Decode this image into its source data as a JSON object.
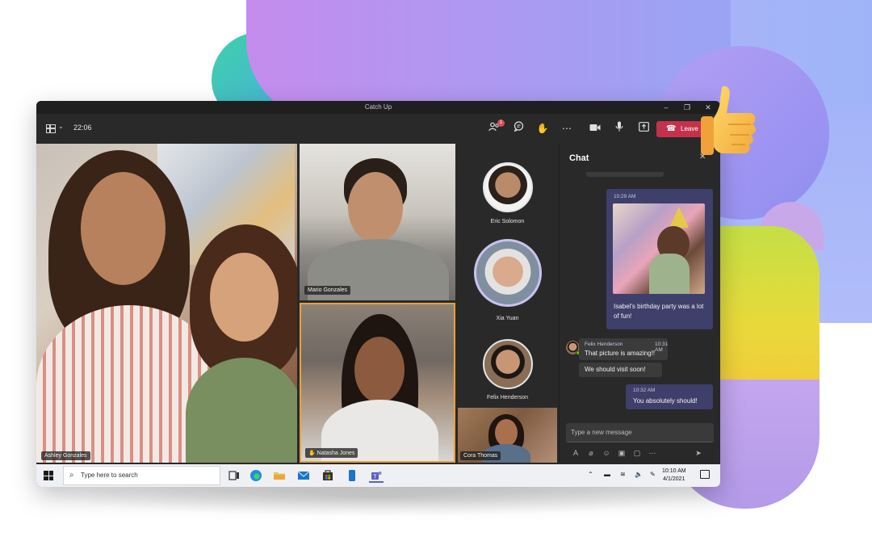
{
  "window": {
    "title": "Catch Up",
    "clock": "22:06",
    "notification_count": "1",
    "leave_label": "Leave"
  },
  "participants": {
    "ashley": "Ashley Gonzales",
    "mario": "Mario Gonzales",
    "natasha": "Natasha Jones",
    "cora": "Cora Thomas",
    "eric": "Eric Solomon",
    "xia": "Xia Yuan",
    "felix": "Felix Henderson"
  },
  "chat": {
    "title": "Chat",
    "messages": [
      {
        "sender": "self",
        "time": "10:29 AM",
        "text": "Isabel's birthday party was a lot of fun!"
      },
      {
        "sender": "Felix Henderson",
        "time": "10:31 AM",
        "text": "That picture is amazing!!"
      },
      {
        "sender": "Felix Henderson",
        "text": "We should visit soon!"
      },
      {
        "sender": "self",
        "time": "10:32 AM",
        "text": "You absolutely should!"
      }
    ],
    "compose_placeholder": "Type a new message"
  },
  "taskbar": {
    "search_placeholder": "Type here to search",
    "time": "10:10 AM",
    "date": "4/1/2021"
  },
  "icons": [
    "grid-icon",
    "participants-icon",
    "chat-icon",
    "raise-hand-icon",
    "more-icon",
    "camera-icon",
    "mic-icon",
    "share-icon",
    "phone-icon",
    "thumbs-up-icon"
  ]
}
